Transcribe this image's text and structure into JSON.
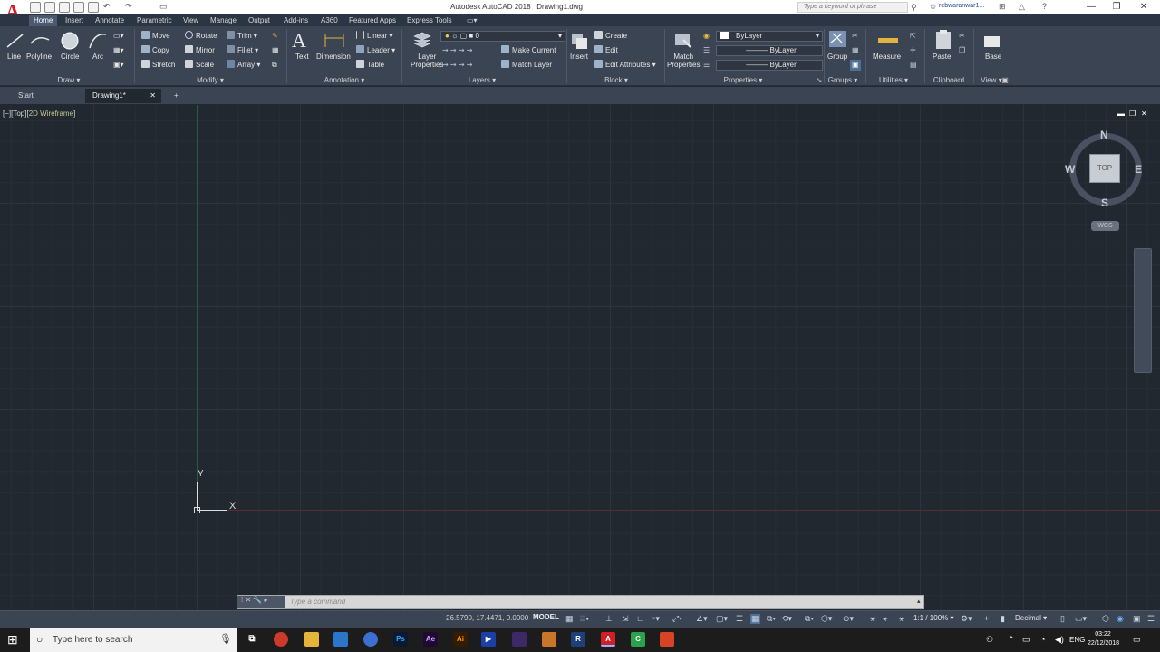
{
  "titlebar": {
    "app_title": "Autodesk AutoCAD 2018",
    "doc_title": "Drawing1.dwg",
    "search_placeholder": "Type a keyword or phrase",
    "user": "rebwaranwar1...",
    "app_letter": "A"
  },
  "ribbon_tabs": [
    "Home",
    "Insert",
    "Annotate",
    "Parametric",
    "View",
    "Manage",
    "Output",
    "Add-ins",
    "A360",
    "Featured Apps",
    "Express Tools"
  ],
  "draw": {
    "line": "Line",
    "polyline": "Polyline",
    "circle": "Circle",
    "arc": "Arc",
    "panel": "Draw"
  },
  "modify": {
    "move": "Move",
    "rotate": "Rotate",
    "trim": "Trim",
    "copy": "Copy",
    "mirror": "Mirror",
    "fillet": "Fillet",
    "stretch": "Stretch",
    "scale": "Scale",
    "array": "Array",
    "panel": "Modify"
  },
  "annotation": {
    "text": "Text",
    "dimension": "Dimension",
    "linear": "Linear",
    "leader": "Leader",
    "table": "Table",
    "panel": "Annotation"
  },
  "layers": {
    "layer_properties_1": "Layer",
    "layer_properties_2": "Properties",
    "current_layer": "0",
    "make_current": "Make Current",
    "match_layer": "Match Layer",
    "panel": "Layers"
  },
  "block": {
    "insert": "Insert",
    "create": "Create",
    "edit": "Edit",
    "edit_attributes": "Edit Attributes",
    "panel": "Block"
  },
  "properties": {
    "match_1": "Match",
    "match_2": "Properties",
    "color": "ByLayer",
    "linetype": "ByLayer",
    "lineweight": "ByLayer",
    "panel": "Properties"
  },
  "groups": {
    "group": "Group",
    "panel": "Groups"
  },
  "utilities": {
    "measure": "Measure",
    "panel": "Utilities"
  },
  "clipboard": {
    "paste": "Paste",
    "panel": "Clipboard"
  },
  "view": {
    "base": "Base",
    "panel": "View"
  },
  "file_tabs": {
    "start": "Start",
    "drawing": "Drawing1*",
    "new": "+"
  },
  "viewport": {
    "controls": "[−][Top][",
    "visual_style": "2D Wireframe",
    "close": "]"
  },
  "ucs": {
    "y": "Y",
    "x": "X"
  },
  "viewcube": {
    "n": "N",
    "s": "S",
    "e": "E",
    "w": "W",
    "top": "TOP",
    "wcs": "WCS"
  },
  "command": {
    "placeholder": "Type a command"
  },
  "status": {
    "coords": "26.5790, 17.4471, 0.0000",
    "model": "MODEL",
    "anno_scale": "1:1 / 100%",
    "units": "Decimal"
  },
  "taskbar": {
    "search": "Type here to search",
    "lang": "ENG",
    "time": "03:22",
    "date": "22/12/2018"
  },
  "icons": {
    "colors": {
      "accent": "#d11f26",
      "ribbon": "#3b4453",
      "canvas": "#212830"
    },
    "apps": [
      "Ps",
      "Ae",
      "Ai",
      "R",
      "A",
      "C"
    ]
  }
}
